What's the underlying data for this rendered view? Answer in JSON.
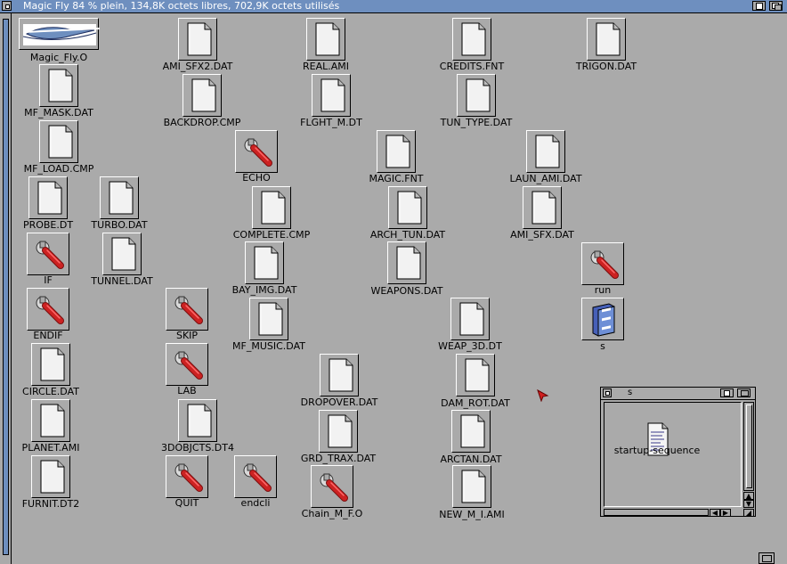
{
  "window": {
    "title": "Magic Fly  84 % plein, 134,8K octets libres, 702,9K octets utilisés"
  },
  "icons": [
    {
      "id": "magic-fly-o",
      "label": "Magic_Fly.O",
      "type": "project"
    },
    {
      "id": "ami-sfx2-dat",
      "label": "AMI_SFX2.DAT",
      "type": "file"
    },
    {
      "id": "real-ami",
      "label": "REAL.AMI",
      "type": "file"
    },
    {
      "id": "credits-fnt",
      "label": "CREDITS.FNT",
      "type": "file"
    },
    {
      "id": "trigon-dat",
      "label": "TRIGON.DAT",
      "type": "file"
    },
    {
      "id": "mf-mask-dat",
      "label": "MF_MASK.DAT",
      "type": "file"
    },
    {
      "id": "backdrop-cmp",
      "label": "BACKDROP.CMP",
      "type": "file"
    },
    {
      "id": "flght-m-dt",
      "label": "FLGHT_M.DT",
      "type": "file"
    },
    {
      "id": "tun-type-dat",
      "label": "TUN_TYPE.DAT",
      "type": "file"
    },
    {
      "id": "mf-load-cmp",
      "label": "MF_LOAD.CMP",
      "type": "file"
    },
    {
      "id": "echo",
      "label": "ECHO",
      "type": "tool"
    },
    {
      "id": "magic-fnt",
      "label": "MAGIC.FNT",
      "type": "file"
    },
    {
      "id": "laun-ami-dat",
      "label": "LAUN_AMI.DAT",
      "type": "file"
    },
    {
      "id": "probe-dt",
      "label": "PROBE.DT",
      "type": "file"
    },
    {
      "id": "turbo-dat",
      "label": "TURBO.DAT",
      "type": "file"
    },
    {
      "id": "complete-cmp",
      "label": "COMPLETE.CMP",
      "type": "file"
    },
    {
      "id": "arch-tun-dat",
      "label": "ARCH_TUN.DAT",
      "type": "file"
    },
    {
      "id": "ami-sfx-dat",
      "label": "AMI_SFX.DAT",
      "type": "file"
    },
    {
      "id": "if",
      "label": "IF",
      "type": "tool"
    },
    {
      "id": "tunnel-dat",
      "label": "TUNNEL.DAT",
      "type": "file"
    },
    {
      "id": "bay-img-dat",
      "label": "BAY_IMG.DAT",
      "type": "file"
    },
    {
      "id": "weapons-dat",
      "label": "WEAPONS.DAT",
      "type": "file"
    },
    {
      "id": "run",
      "label": "run",
      "type": "tool"
    },
    {
      "id": "endif",
      "label": "ENDIF",
      "type": "tool"
    },
    {
      "id": "skip",
      "label": "SKIP",
      "type": "tool"
    },
    {
      "id": "mf-music-dat",
      "label": "MF_MUSIC.DAT",
      "type": "file"
    },
    {
      "id": "weap-3d-dt",
      "label": "WEAP_3D.DT",
      "type": "file"
    },
    {
      "id": "s-drawer",
      "label": "s",
      "type": "drawer"
    },
    {
      "id": "circle-dat",
      "label": "CIRCLE.DAT",
      "type": "file"
    },
    {
      "id": "lab",
      "label": "LAB",
      "type": "tool"
    },
    {
      "id": "dropover-dat",
      "label": "DROPOVER.DAT",
      "type": "file"
    },
    {
      "id": "dam-rot-dat",
      "label": "DAM_ROT.DAT",
      "type": "file"
    },
    {
      "id": "planet-ami",
      "label": "PLANET.AMI",
      "type": "file"
    },
    {
      "id": "3dobjcts-dt4",
      "label": "3DOBJCTS.DT4",
      "type": "file"
    },
    {
      "id": "grd-trax-dat",
      "label": "GRD_TRAX.DAT",
      "type": "file"
    },
    {
      "id": "arctan-dat",
      "label": "ARCTAN.DAT",
      "type": "file"
    },
    {
      "id": "furnit-dt2",
      "label": "FURNIT.DT2",
      "type": "file"
    },
    {
      "id": "quit",
      "label": "QUIT",
      "type": "tool"
    },
    {
      "id": "endcli",
      "label": "endcli",
      "type": "tool"
    },
    {
      "id": "chain-m-f-o",
      "label": "Chain_M_F.O",
      "type": "tool"
    },
    {
      "id": "new-m-i-ami",
      "label": "NEW_M_I.AMI",
      "type": "file"
    }
  ],
  "subwindow": {
    "title": "s",
    "icons": [
      {
        "id": "startup-sequence",
        "label": "startup-sequence",
        "type": "text"
      }
    ]
  },
  "colors": {
    "background": "#aaaaaa",
    "titlebar": "#6e8fbf",
    "tool_red": "#cc2222"
  }
}
